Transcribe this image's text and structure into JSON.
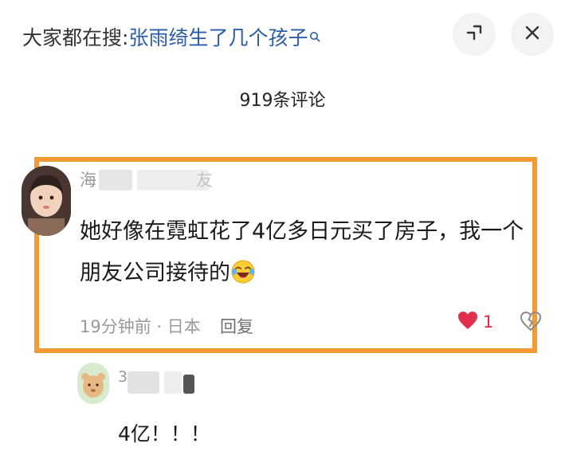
{
  "header": {
    "search_prefix": "大家都在搜:",
    "search_query": "张雨绮生了几个孩子"
  },
  "comments_section": {
    "count_label": "919条评论"
  },
  "main_comment": {
    "username": "海",
    "username_tail": "友",
    "text": "她好像在霓虹花了4亿多日元买了房子，我一个朋友公司接待的",
    "time_location": "19分钟前 · 日本",
    "reply_label": "回复",
    "like_count": "1"
  },
  "reply_comment": {
    "username": "3",
    "text": "4亿！！！"
  },
  "colors": {
    "highlight_border": "#f39a32",
    "link_blue": "#2c5da8",
    "like_red": "#d9304a"
  }
}
